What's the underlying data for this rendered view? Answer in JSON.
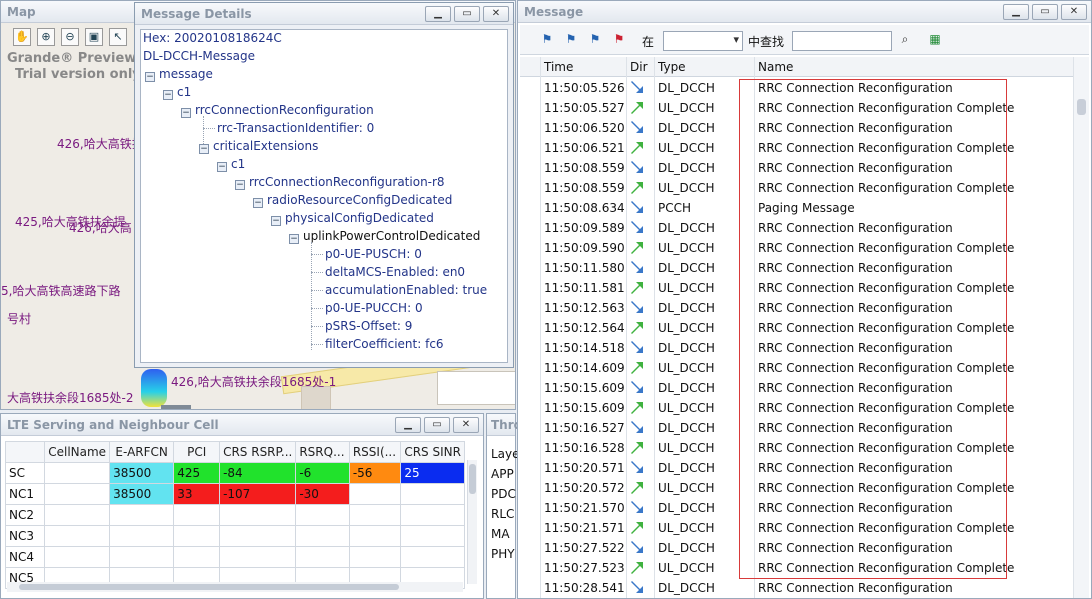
{
  "map": {
    "title": "Map",
    "watermark_line1": "Grande® Preview. C",
    "watermark_line2": "Trial version only. (",
    "labels": [
      "426,哈大高铁扶余",
      "425,哈大高铁扶余提",
      "426,哈大高",
      "5,哈大高铁高速路下路",
      "号村",
      "大高铁扶余段1685处-2",
      "426,哈大高铁扶余段1685处-1"
    ],
    "tools": [
      "hand-icon",
      "zoom-in-icon",
      "zoom-out-icon",
      "fit-icon",
      "pointer-icon"
    ]
  },
  "details": {
    "title": "Message Details",
    "hex": "Hex: 2002010818624C",
    "root": "DL-DCCH-Message",
    "nodes": [
      "message",
      "c1",
      "rrcConnectionReconfiguration",
      "rrc-TransactionIdentifier",
      "criticalExtensions",
      "c1",
      "rrcConnectionReconfiguration-r8",
      "radioResourceConfigDedicated",
      "physicalConfigDedicated",
      "uplinkPowerControlDedicated"
    ],
    "tid_value": "0",
    "fields": [
      {
        "key": "p0-UE-PUSCH",
        "value": "0"
      },
      {
        "key": "deltaMCS-Enabled",
        "value": "en0"
      },
      {
        "key": "accumulationEnabled",
        "value": "true"
      },
      {
        "key": "p0-UE-PUCCH",
        "value": "0"
      },
      {
        "key": "pSRS-Offset",
        "value": "9"
      },
      {
        "key": "filterCoefficient",
        "value": "fc6"
      }
    ]
  },
  "lte": {
    "title": "LTE Serving and Neighbour Cell",
    "columns": [
      "",
      "CellName",
      "E-ARFCN",
      "PCI",
      "CRS RSRP...",
      "RSRQ...",
      "RSSI(...",
      "CRS SINR"
    ],
    "rows": [
      {
        "label": "SC",
        "earfcn": "38500",
        "pci": "425",
        "rsrp": "-84",
        "rsrq": "-6",
        "rssi": "-56",
        "sinr": "25"
      },
      {
        "label": "NC1",
        "earfcn": "38500",
        "pci": "33",
        "rsrp": "-107",
        "rsrq": "-30",
        "rssi": "",
        "sinr": ""
      },
      {
        "label": "NC2"
      },
      {
        "label": "NC3"
      },
      {
        "label": "NC4"
      },
      {
        "label": "NC5"
      }
    ]
  },
  "throughput": {
    "title": "Thro",
    "items": [
      "Laye",
      "APP",
      "PDC",
      "RLC",
      "MA",
      "PHY"
    ]
  },
  "message": {
    "title": "Message",
    "filter_prefix": "在",
    "filter_suffix": "中查找",
    "columns": {
      "time": "Time",
      "dir": "Dir",
      "type": "Type",
      "name": "Name"
    },
    "rows": [
      {
        "time": "11:50:05.526",
        "dir": "down",
        "type": "DL_DCCH",
        "name": "RRC Connection Reconfiguration"
      },
      {
        "time": "11:50:05.527",
        "dir": "up",
        "type": "UL_DCCH",
        "name": "RRC Connection Reconfiguration Complete"
      },
      {
        "time": "11:50:06.520",
        "dir": "down",
        "type": "DL_DCCH",
        "name": "RRC Connection Reconfiguration"
      },
      {
        "time": "11:50:06.521",
        "dir": "up",
        "type": "UL_DCCH",
        "name": "RRC Connection Reconfiguration Complete"
      },
      {
        "time": "11:50:08.559",
        "dir": "down",
        "type": "DL_DCCH",
        "name": "RRC Connection Reconfiguration"
      },
      {
        "time": "11:50:08.559",
        "dir": "up",
        "type": "UL_DCCH",
        "name": "RRC Connection Reconfiguration Complete"
      },
      {
        "time": "11:50:08.634",
        "dir": "down",
        "type": "PCCH",
        "name": "Paging Message"
      },
      {
        "time": "11:50:09.589",
        "dir": "down",
        "type": "DL_DCCH",
        "name": "RRC Connection Reconfiguration"
      },
      {
        "time": "11:50:09.590",
        "dir": "up",
        "type": "UL_DCCH",
        "name": "RRC Connection Reconfiguration Complete"
      },
      {
        "time": "11:50:11.580",
        "dir": "down",
        "type": "DL_DCCH",
        "name": "RRC Connection Reconfiguration"
      },
      {
        "time": "11:50:11.581",
        "dir": "up",
        "type": "UL_DCCH",
        "name": "RRC Connection Reconfiguration Complete"
      },
      {
        "time": "11:50:12.563",
        "dir": "down",
        "type": "DL_DCCH",
        "name": "RRC Connection Reconfiguration"
      },
      {
        "time": "11:50:12.564",
        "dir": "up",
        "type": "UL_DCCH",
        "name": "RRC Connection Reconfiguration Complete"
      },
      {
        "time": "11:50:14.518",
        "dir": "down",
        "type": "DL_DCCH",
        "name": "RRC Connection Reconfiguration"
      },
      {
        "time": "11:50:14.609",
        "dir": "up",
        "type": "UL_DCCH",
        "name": "RRC Connection Reconfiguration Complete"
      },
      {
        "time": "11:50:15.609",
        "dir": "down",
        "type": "DL_DCCH",
        "name": "RRC Connection Reconfiguration"
      },
      {
        "time": "11:50:15.609",
        "dir": "up",
        "type": "UL_DCCH",
        "name": "RRC Connection Reconfiguration Complete"
      },
      {
        "time": "11:50:16.527",
        "dir": "down",
        "type": "DL_DCCH",
        "name": "RRC Connection Reconfiguration"
      },
      {
        "time": "11:50:16.528",
        "dir": "up",
        "type": "UL_DCCH",
        "name": "RRC Connection Reconfiguration Complete"
      },
      {
        "time": "11:50:20.571",
        "dir": "down",
        "type": "DL_DCCH",
        "name": "RRC Connection Reconfiguration"
      },
      {
        "time": "11:50:20.572",
        "dir": "up",
        "type": "UL_DCCH",
        "name": "RRC Connection Reconfiguration Complete"
      },
      {
        "time": "11:50:21.570",
        "dir": "down",
        "type": "DL_DCCH",
        "name": "RRC Connection Reconfiguration"
      },
      {
        "time": "11:50:21.571",
        "dir": "up",
        "type": "UL_DCCH",
        "name": "RRC Connection Reconfiguration Complete"
      },
      {
        "time": "11:50:27.522",
        "dir": "down",
        "type": "DL_DCCH",
        "name": "RRC Connection Reconfiguration"
      },
      {
        "time": "11:50:27.523",
        "dir": "up",
        "type": "UL_DCCH",
        "name": "RRC Connection Reconfiguration Complete"
      },
      {
        "time": "11:50:28.541",
        "dir": "down",
        "type": "DL_DCCH",
        "name": "RRC Connection Reconfiguration"
      }
    ]
  },
  "colors": {
    "down_arrow": "#3a78c9",
    "up_arrow": "#3fb23f",
    "highlight_box": "#d83a3a",
    "tree_text": "#223488"
  }
}
